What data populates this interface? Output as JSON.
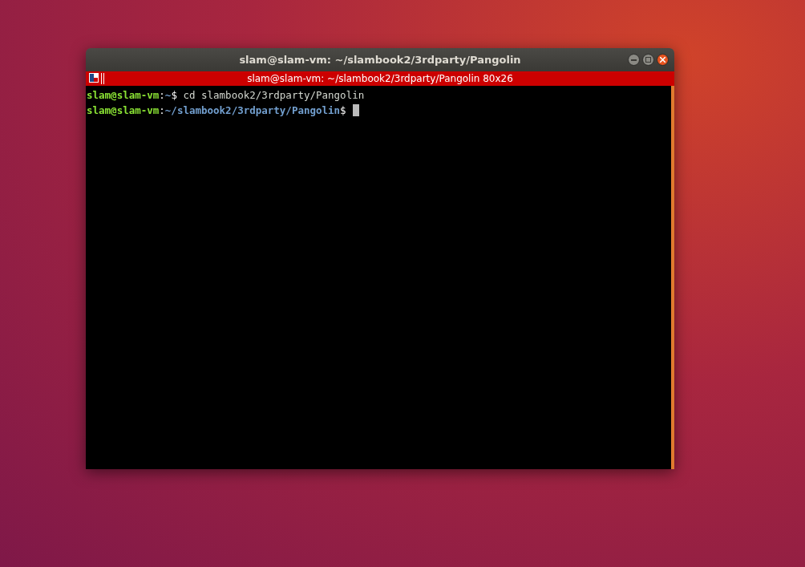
{
  "window": {
    "title": "slam@slam-vm: ~/slambook2/3rdparty/Pangolin"
  },
  "terminal_bar": {
    "title": "slam@slam-vm: ~/slambook2/3rdparty/Pangolin 80x26"
  },
  "lines": [
    {
      "user": "slam@slam-vm",
      "colon": ":",
      "path": "~",
      "dollar": "$",
      "command": "cd slambook2/3rdparty/Pangolin",
      "cursor": false
    },
    {
      "user": "slam@slam-vm",
      "colon": ":",
      "path": "~/slambook2/3rdparty/Pangolin",
      "dollar": "$",
      "cursor": true
    }
  ]
}
